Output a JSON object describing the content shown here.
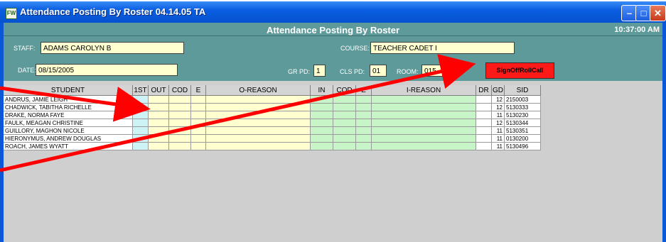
{
  "window": {
    "title": "Attendance Posting By Roster 04.14.05 TA",
    "minimize": "–",
    "maximize": "□",
    "close": "✕"
  },
  "header": {
    "title": "Attendance Posting By Roster",
    "time": "10:37:00 AM"
  },
  "form": {
    "staff_label": "STAFF:",
    "staff_value": "ADAMS CAROLYN B",
    "course_label": "COURSE:",
    "course_value": "TEACHER CADET I",
    "date_label": "DATE:",
    "date_value": "08/15/2005",
    "grpd_label": "GR PD:",
    "grpd_value": "1",
    "clspd_label": "CLS PD:",
    "clspd_value": "01",
    "room_label": "ROOM:",
    "room_value": "015",
    "signoff_label": "SignOffRollCall"
  },
  "table": {
    "columns": [
      "STUDENT",
      "1ST",
      "OUT",
      "COD",
      "E",
      "O-REASON",
      "IN",
      "COD",
      "E",
      "I-REASON",
      "DR",
      "GD",
      "SID"
    ],
    "rows": [
      {
        "student": "ANDRUS, JAMIE LEIGH",
        "gd": "12",
        "sid": "2150003"
      },
      {
        "student": "CHADWICK, TABITHA RICHELLE",
        "gd": "12",
        "sid": "5130333"
      },
      {
        "student": "DRAKE, NORMA FAYE",
        "gd": "11",
        "sid": "5130230"
      },
      {
        "student": "FAULK, MEAGAN CHRISTINE",
        "gd": "12",
        "sid": "5130344"
      },
      {
        "student": "GUILLORY, MAGHON NICOLE",
        "gd": "11",
        "sid": "5130351"
      },
      {
        "student": "HIERONYMUS, ANDREW DOUGLAS",
        "gd": "11",
        "sid": "0130200"
      },
      {
        "student": "ROACH, JAMES WYATT",
        "gd": "11",
        "sid": "5130496"
      }
    ]
  },
  "colors": {
    "header_band": "#5f9a9a",
    "field_bg": "#ffffd0",
    "signoff_bg": "#ff1a1a",
    "col_1st": "#cdf3f7",
    "col_out": "#ffffd0",
    "col_in": "#c8f5c8",
    "arrow": "#ff0000"
  }
}
